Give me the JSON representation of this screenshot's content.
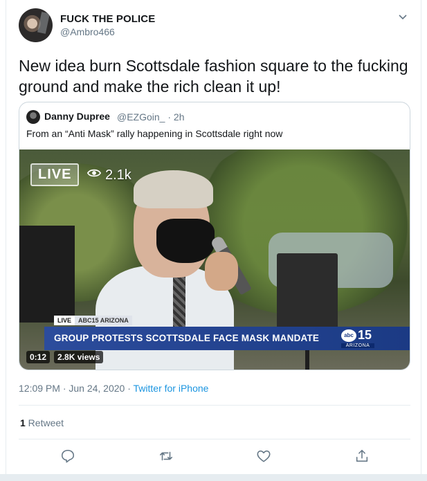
{
  "tweet": {
    "author_name": "FUCK THE POLICE",
    "author_handle": "@Ambro466",
    "text": "New idea burn Scottsdale fashion square to the fucking ground and make the rich clean it up!",
    "timestamp": "12:09 PM · Jun 24, 2020 · ",
    "source": "Twitter for iPhone",
    "retweet_count": "1",
    "retweet_label": " Retweet"
  },
  "quote": {
    "author_name": "Danny Dupree",
    "author_handle": "@EZGoin_ · 2h",
    "text": "From an “Anti Mask” rally happening in Scottsdale right now"
  },
  "video": {
    "live_label": "LIVE",
    "viewers": "2.1k",
    "chyron_live": "LIVE",
    "chyron_station": "ABC15 ARIZONA",
    "headline": "GROUP PROTESTS SCOTTSDALE FACE MASK MANDATE",
    "logo_text": "15",
    "logo_abc": "abc",
    "logo_region": "ARIZONA",
    "elapsed": "0:12",
    "views": "2.8K views"
  },
  "icons": [
    "chevron-down-icon",
    "eye-icon",
    "reply-icon",
    "retweet-icon",
    "like-icon",
    "share-icon"
  ],
  "colors": {
    "link": "#1b95e0",
    "muted": "#657786",
    "chyron": "#1b3a84"
  }
}
